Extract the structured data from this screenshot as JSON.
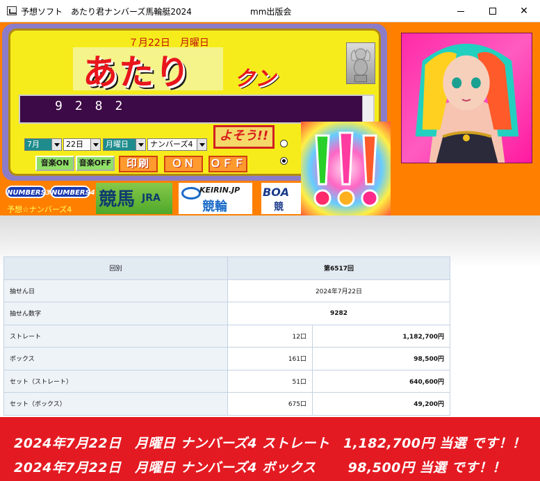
{
  "window": {
    "title": "予想ソフト　あたり君ナンバーズ馬輪艇2024",
    "publisher": "mm出版会",
    "minimize_label": "",
    "maximize_label": "",
    "close_label": "✕"
  },
  "app": {
    "date_heading": "７月22日　月曜日",
    "logo_main": "あたり",
    "logo_sub": "クン",
    "number_display": "9282",
    "selects": {
      "month": "7月",
      "day": "22日",
      "weekday": "月曜日",
      "game": "ナンバーズ4"
    },
    "buttons": {
      "music_on": "音楽ON",
      "music_off": "音楽OFF",
      "print": "印刷",
      "on": "ＯＮ",
      "off": "ＯＦＦ",
      "predict": "よそう!!"
    },
    "logos": {
      "numbers3": "NUMBERS3",
      "numbers4": "NUMBERS4",
      "numbers_caption": "予想☆ナンバーズ4",
      "keiba": "競馬",
      "jra": "JRA",
      "keirin_jp": "KEIRIN.JP",
      "keirin": "競輪",
      "boat": "BOA",
      "boat_sub": "競"
    }
  },
  "results": {
    "header": {
      "label": "回別",
      "value": "第6517回"
    },
    "draw_date": {
      "label": "抽せん日",
      "value": "2024年7月22日"
    },
    "winning_number": {
      "label": "抽せん数字",
      "value": "9282"
    },
    "rows": [
      {
        "label": "ストレート",
        "count": "12口",
        "amount": "1,182,700円"
      },
      {
        "label": "ボックス",
        "count": "161口",
        "amount": "98,500円"
      },
      {
        "label": "セット（ストレート）",
        "count": "51口",
        "amount": "640,600円"
      },
      {
        "label": "セット（ボックス）",
        "count": "675口",
        "amount": "49,200円"
      }
    ]
  },
  "banner": {
    "line1": "2024年7月22日　月曜日 ナンバーズ4 ストレート　1,182,700円 当選 です！！",
    "line2": "2024年7月22日　月曜日 ナンバーズ4 ボックス　　 98,500円 当選 です！！"
  },
  "colors": {
    "app_bg": "#ff8000",
    "panel_yellow": "#f7ec1b",
    "banner_red": "#e41a22",
    "display_purple": "#3c0a46"
  }
}
